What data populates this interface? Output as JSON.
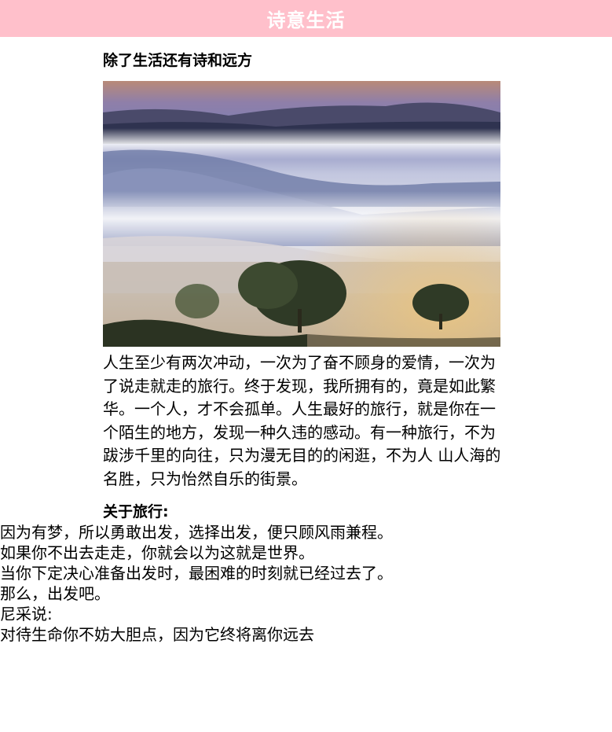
{
  "header": {
    "title": "诗意生活"
  },
  "article": {
    "heading": "除了生活还有诗和远方",
    "paragraph": "人生至少有两次冲动，一次为了奋不顾身的爱情，一次为了说走就走的旅行。终于发现，我所拥有的，竟是如此繁华。一个人，才不会孤单。人生最好的旅行，就是你在一个陌生的地方，发现一种久违的感动。有一种旅行，不为跋涉千里的向往，只为漫无目的的闲逛，不为人 山人海的名胜，只为怡然自乐的街景。",
    "about_heading": "关于旅行:",
    "quotes": [
      {
        "text": "因为有梦，所以勇敢出发，选择出发，便只顾风雨兼程。"
      },
      {
        "text": "如果你不出去走走，你就会以为这就是世界。"
      },
      {
        "text": "当你下定决心准备出发时，最困难的时刻就已经过去了。那么，出发吧。",
        "extra": [
          "尼采说:",
          "对待生命你不妨大胆点，因为它终将离你远去"
        ]
      }
    ]
  },
  "colors": {
    "header_bg": "#ffc0cb",
    "header_text": "#ffffff"
  }
}
